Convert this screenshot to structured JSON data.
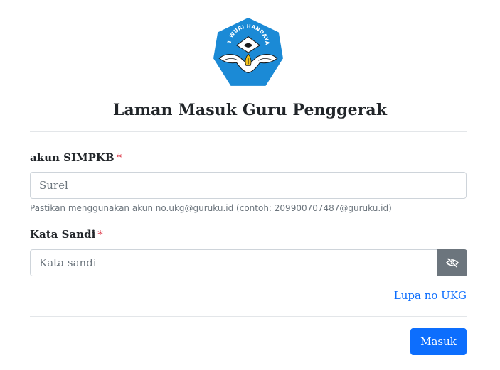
{
  "logo": {
    "name": "tut-wuri-handayani-logo",
    "text": "TUT WURI HANDAYANI",
    "colors": {
      "blue": "#1b8ad6",
      "gold": "#f3c31d",
      "dark": "#1a1a1a"
    }
  },
  "page": {
    "title": "Laman Masuk Guru Penggerak"
  },
  "form": {
    "email": {
      "label": "akun SIMPKB",
      "required_mark": "*",
      "placeholder": "Surel",
      "value": "",
      "hint": "Pastikan menggunakan akun no.ukg@guruku.id (contoh: 209900707487@guruku.id)"
    },
    "password": {
      "label": "Kata Sandi",
      "required_mark": "*",
      "placeholder": "Kata sandi",
      "value": "",
      "toggle_icon": "eye-slash-icon"
    },
    "forgot_link": "Lupa no UKG",
    "submit_label": "Masuk"
  },
  "colors": {
    "primary": "#0d6efd",
    "secondary": "#6c757d",
    "required": "#dc3545",
    "text": "#212529"
  }
}
